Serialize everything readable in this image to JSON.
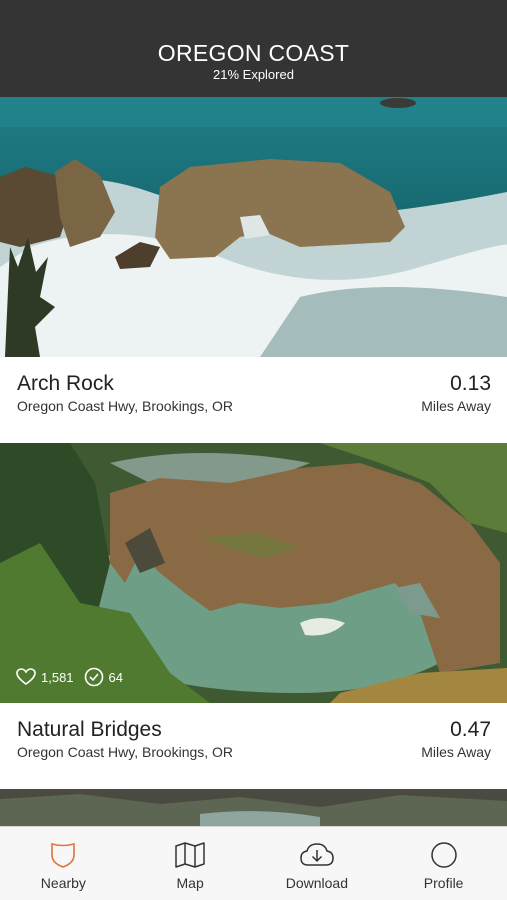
{
  "header": {
    "title": "OREGON COAST",
    "subtitle": "21% Explored"
  },
  "places": [
    {
      "name": "Arch Rock",
      "address": "Oregon Coast Hwy, Brookings, OR",
      "distance": "0.13",
      "distance_unit": "Miles Away"
    },
    {
      "name": "Natural Bridges",
      "address": "Oregon Coast Hwy, Brookings, OR",
      "distance": "0.47",
      "distance_unit": "Miles Away",
      "likes": "1,581",
      "checkins": "64"
    }
  ],
  "tabs": [
    {
      "label": "Nearby",
      "icon": "shield-icon",
      "active": true
    },
    {
      "label": "Map",
      "icon": "map-icon"
    },
    {
      "label": "Download",
      "icon": "cloud-download-icon"
    },
    {
      "label": "Profile",
      "icon": "profile-icon"
    }
  ],
  "colors": {
    "header_bg": "#343434",
    "accent": "#e0733e",
    "tabbar_bg": "#f7f7f7"
  }
}
